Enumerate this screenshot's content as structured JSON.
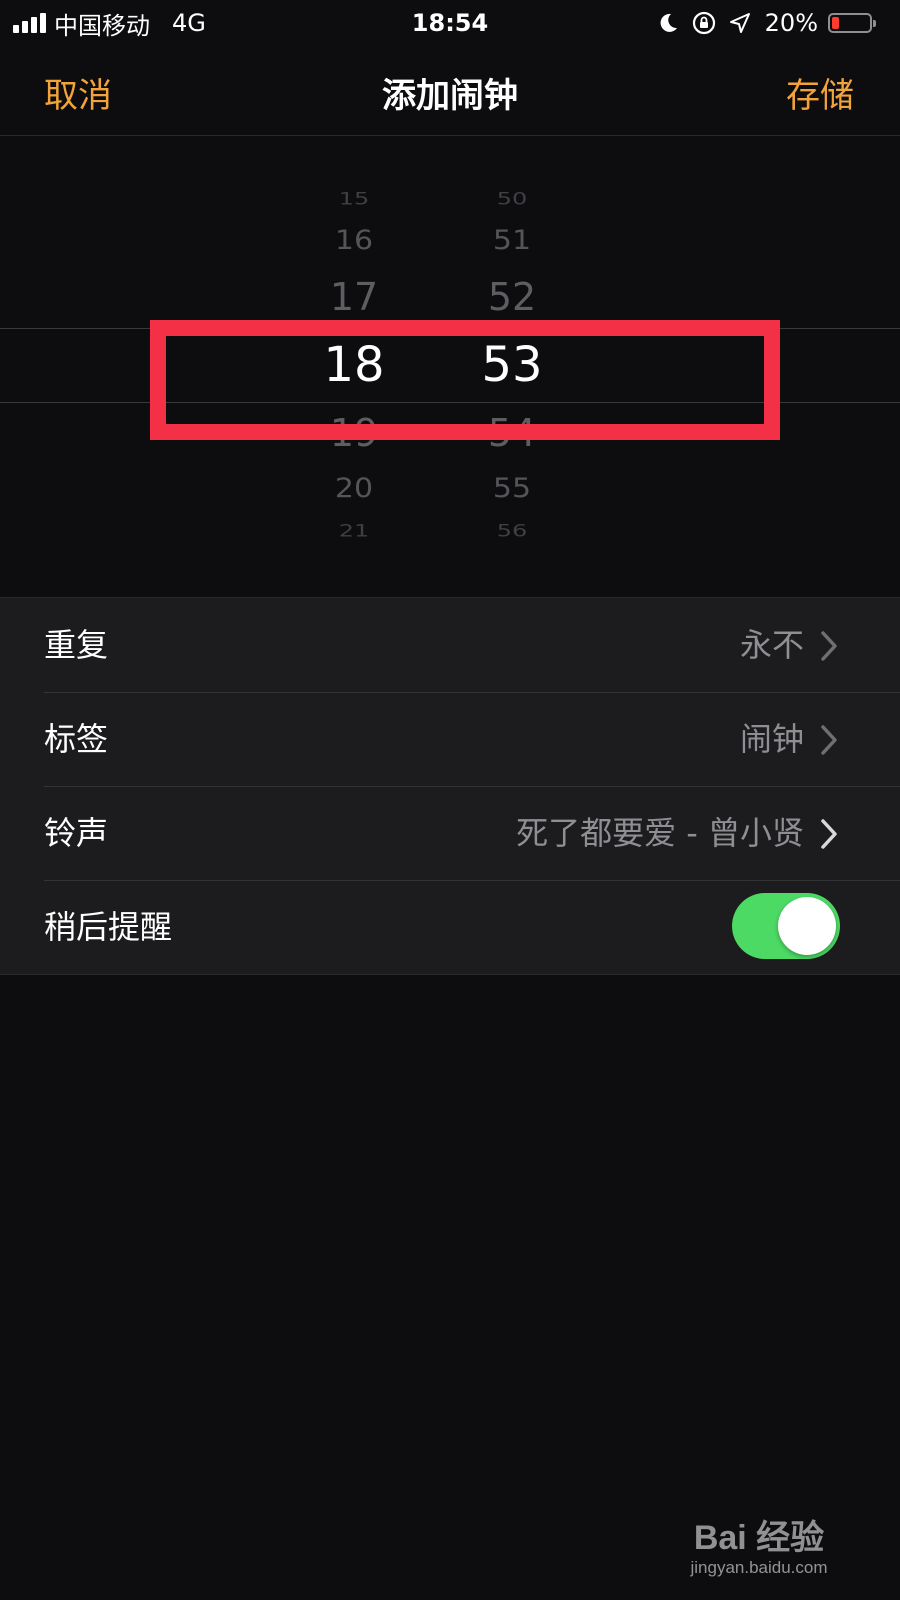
{
  "status_bar": {
    "carrier": "中国移动",
    "network": "4G",
    "time": "18:54",
    "battery_percent": "20%",
    "battery_level": 0.2,
    "icons": [
      "signal-icon",
      "moon-icon",
      "rotation-lock-icon",
      "location-arrow-icon",
      "battery-icon"
    ]
  },
  "nav": {
    "cancel_label": "取消",
    "title": "添加闹钟",
    "save_label": "存储"
  },
  "picker": {
    "hours": [
      "15",
      "16",
      "17",
      "18",
      "19",
      "20",
      "21"
    ],
    "minutes": [
      "50",
      "51",
      "52",
      "53",
      "54",
      "55",
      "56"
    ],
    "selected_hour": "18",
    "selected_minute": "53"
  },
  "settings": {
    "repeat": {
      "label": "重复",
      "value": "永不"
    },
    "label": {
      "label": "标签",
      "value": "闹钟"
    },
    "sound": {
      "label": "铃声",
      "value": "死了都要爱 - 曾小贤"
    },
    "snooze": {
      "label": "稍后提醒",
      "enabled": true
    }
  },
  "watermark": {
    "logo": "Bai 经验",
    "url": "jingyan.baidu.com"
  },
  "colors": {
    "accent": "#f2a33a",
    "toggle_on": "#4cd964",
    "highlight": "#f33046",
    "battery_low": "#ff3b30"
  }
}
